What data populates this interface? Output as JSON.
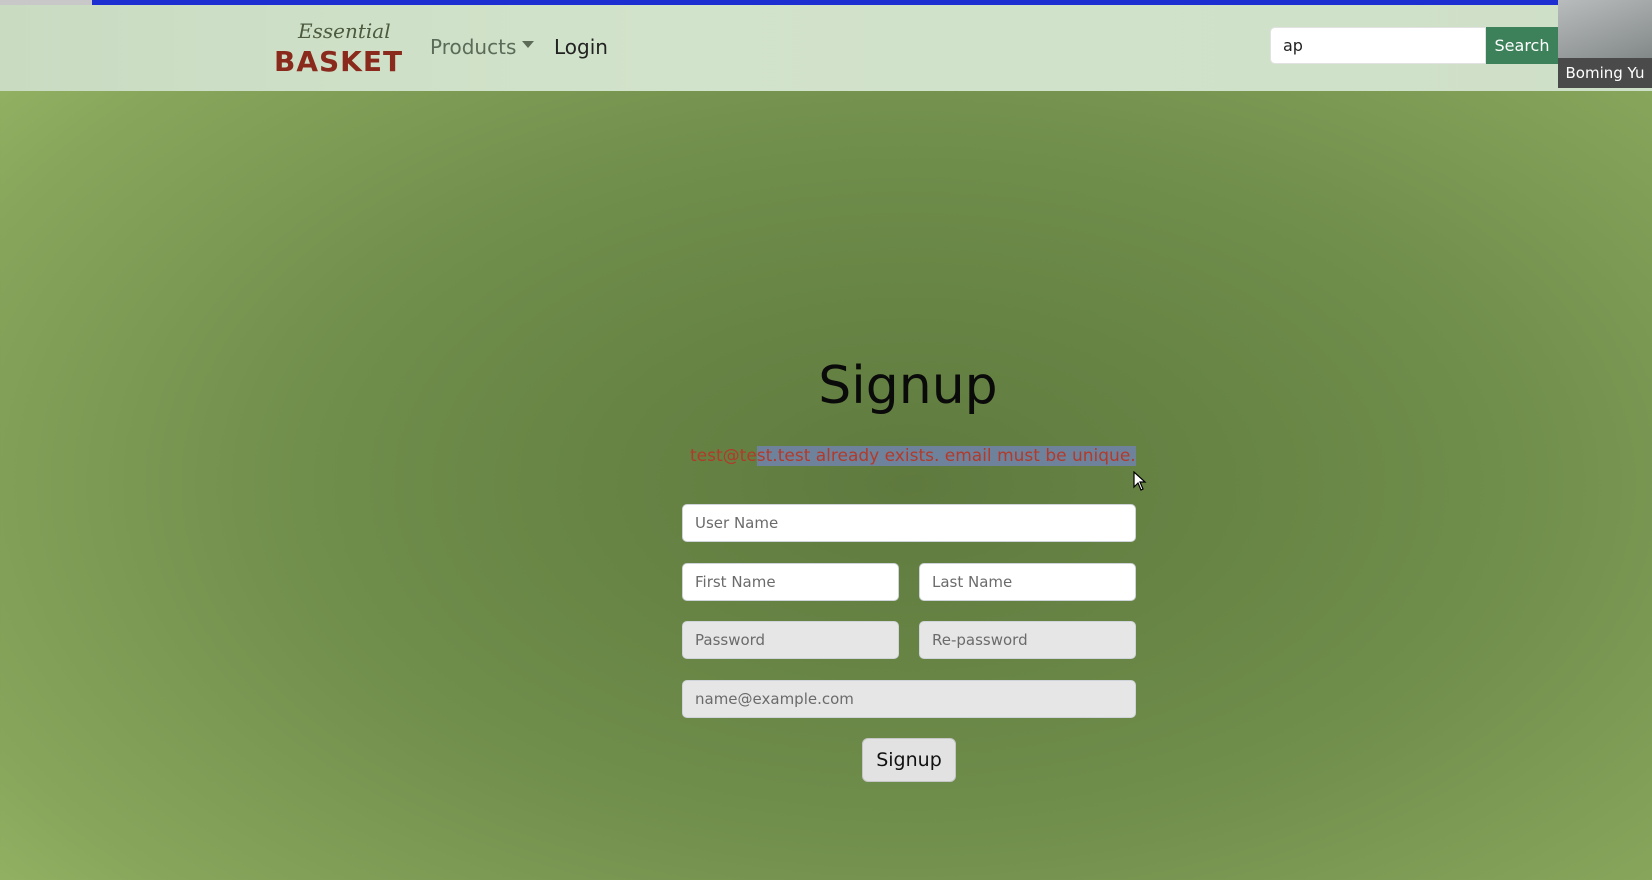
{
  "navbar": {
    "logo_script": "Essential",
    "logo_main": "BASKET",
    "products_label": "Products",
    "login_label": "Login",
    "search_value": "ap",
    "search_button": "Search"
  },
  "webcam": {
    "name": "Boming Yu"
  },
  "form": {
    "title": "Signup",
    "error_prefix": "test@te",
    "error_highlighted": "st.test already exists. email must be unique.",
    "username_placeholder": "User Name",
    "firstname_placeholder": "First Name",
    "lastname_placeholder": "Last Name",
    "password_placeholder": "Password",
    "repassword_placeholder": "Re-password",
    "email_placeholder": "name@example.com",
    "submit_label": "Signup"
  },
  "colors": {
    "navbar_bg": "#cfe0c8",
    "search_button_bg": "#3c8159",
    "logo_text": "#8a2a1c",
    "error_text": "#b23a2a",
    "highlight_bg": "#6f829c",
    "page_bg": "#6e8c4a"
  }
}
